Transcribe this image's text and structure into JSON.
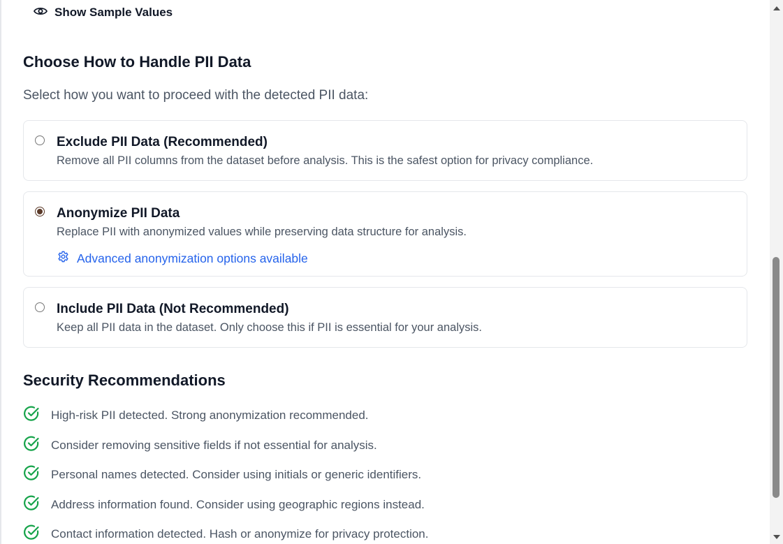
{
  "sample_toggle": {
    "icon": "eye-icon",
    "label": "Show Sample Values"
  },
  "pii_section": {
    "title": "Choose How to Handle PII Data",
    "intro": "Select how you want to proceed with the detected PII data:",
    "options": [
      {
        "title": "Exclude PII Data (Recommended)",
        "description": "Remove all PII columns from the dataset before analysis. This is the safest option for privacy compliance.",
        "selected": false
      },
      {
        "title": "Anonymize PII Data",
        "description": "Replace PII with anonymized values while preserving data structure for analysis.",
        "selected": true,
        "advanced_link": {
          "icon": "gear-icon",
          "label": "Advanced anonymization options available"
        }
      },
      {
        "title": "Include PII Data (Not Recommended)",
        "description": "Keep all PII data in the dataset. Only choose this if PII is essential for your analysis.",
        "selected": false
      }
    ]
  },
  "security_section": {
    "title": "Security Recommendations",
    "items": [
      "High-risk PII detected. Strong anonymization recommended.",
      "Consider removing sensitive fields if not essential for analysis.",
      "Personal names detected. Consider using initials or generic identifiers.",
      "Address information found. Consider using geographic regions instead.",
      "Contact information detected. Hash or anonymize for privacy protection."
    ],
    "item_icon": "check-circle-icon"
  },
  "colors": {
    "heading": "#111827",
    "body_text": "#4b5563",
    "link": "#2563eb",
    "check_green": "#16a34a",
    "radio_selected": "#5b3a29",
    "card_border": "#e5e7eb"
  }
}
